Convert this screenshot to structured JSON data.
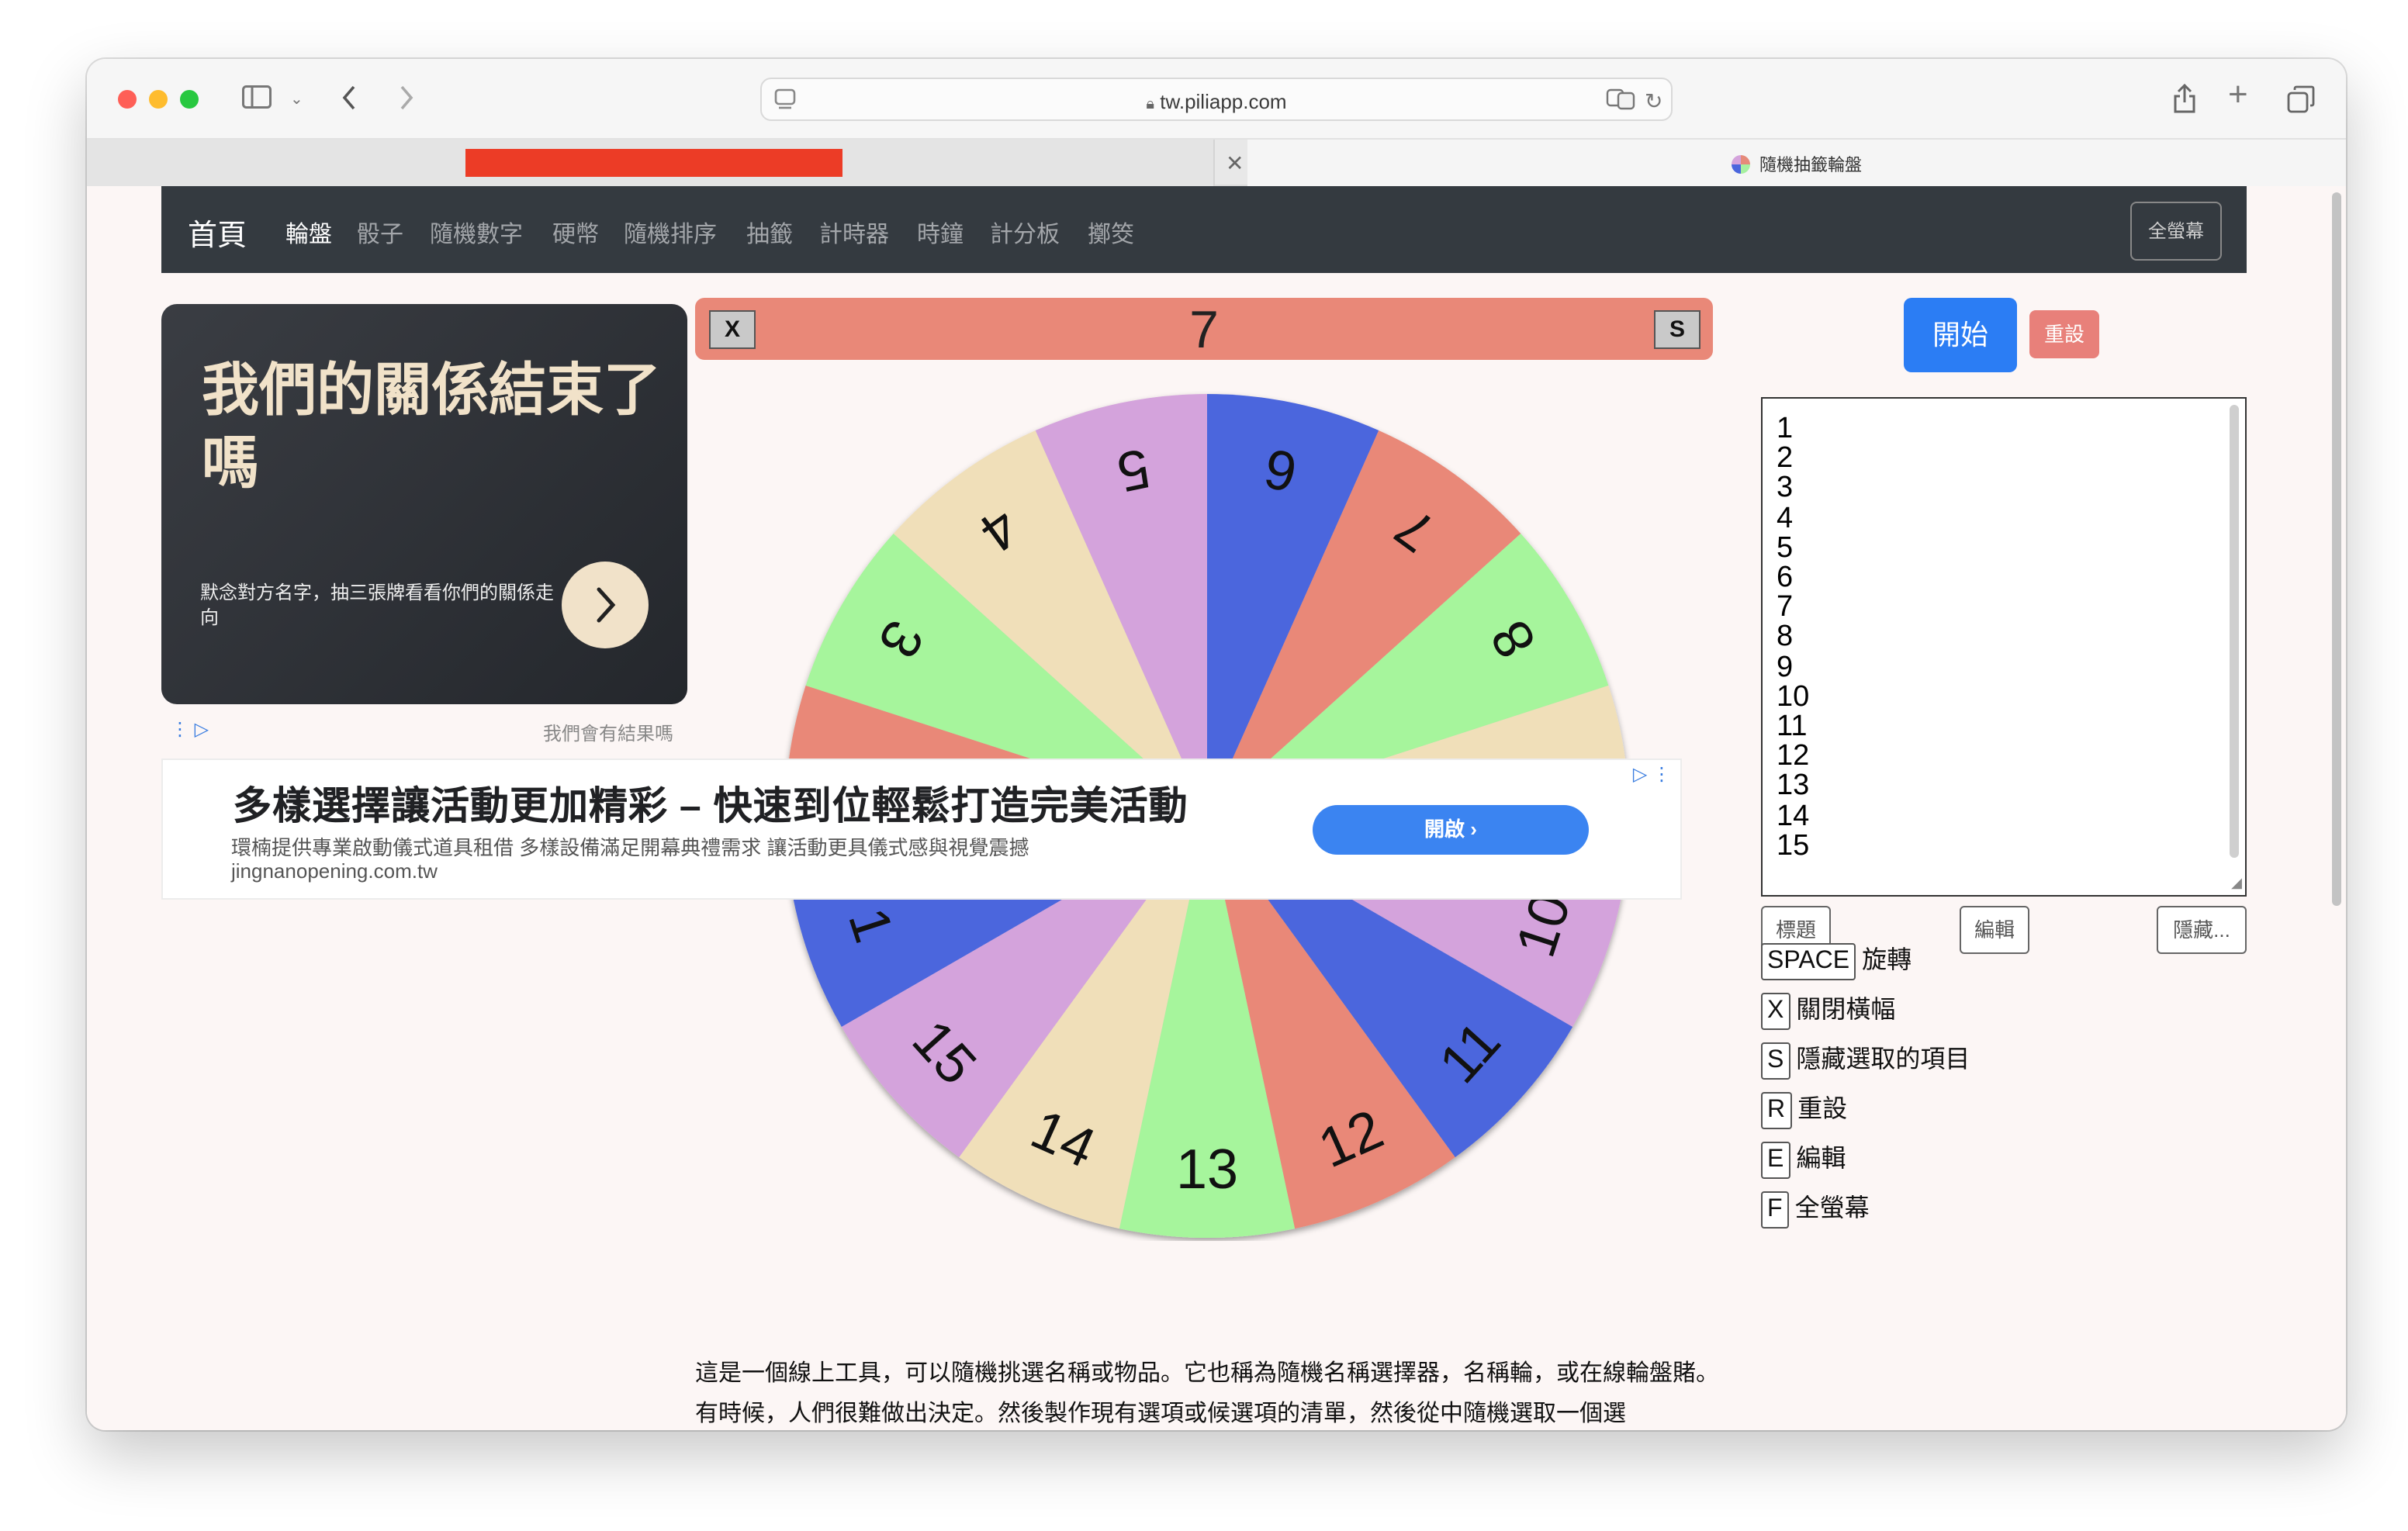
{
  "browser": {
    "url": "tw.piliapp.com",
    "tab_title": "隨機抽籤輪盤"
  },
  "nav": {
    "brand": "首頁",
    "items": [
      {
        "label": "輪盤",
        "active": true
      },
      {
        "label": "骰子",
        "active": false
      },
      {
        "label": "隨機數字",
        "active": false
      },
      {
        "label": "硬幣",
        "active": false
      },
      {
        "label": "隨機排序",
        "active": false
      },
      {
        "label": "抽籤",
        "active": false
      },
      {
        "label": "計時器",
        "active": false
      },
      {
        "label": "時鐘",
        "active": false
      },
      {
        "label": "計分板",
        "active": false
      },
      {
        "label": "擲筊",
        "active": false
      }
    ],
    "fullscreen": "全螢幕"
  },
  "ad_top": {
    "title": "我們的關係結束了嗎",
    "subtitle": "默念對方名字，抽三張牌看看你們的關係走向",
    "caption": "我們會有結果嗎"
  },
  "banner": {
    "close_key": "X",
    "hide_key": "S",
    "selected": "7"
  },
  "wheel": {
    "items": [
      "1",
      "2",
      "3",
      "4",
      "5",
      "6",
      "7",
      "8",
      "9",
      "10",
      "11",
      "12",
      "13",
      "14",
      "15"
    ],
    "colors": [
      "#4b66dd",
      "#e98878",
      "#a6f59c",
      "#f0dfb9",
      "#d4a3dc"
    ]
  },
  "ad_banner": {
    "headline": "多樣選擇讓活動更加精彩 – 快速到位輕鬆打造完美活動",
    "description": "環楠提供專業啟動儀式道具租借 多樣設備滿足開幕典禮需求 讓活動更具儀式感與視覺震撼",
    "url": "jingnanopening.com.tw",
    "cta": "開啟"
  },
  "controls": {
    "start": "開始",
    "reset": "重設",
    "title_btn": "標題",
    "edit_btn": "編輯",
    "hide_btn": "隱藏..."
  },
  "list": [
    "1",
    "2",
    "3",
    "4",
    "5",
    "6",
    "7",
    "8",
    "9",
    "10",
    "11",
    "12",
    "13",
    "14",
    "15"
  ],
  "shortcuts": [
    {
      "key": "SPACE",
      "label": "旋轉"
    },
    {
      "key": "X",
      "label": "關閉橫幅"
    },
    {
      "key": "S",
      "label": "隱藏選取的項目"
    },
    {
      "key": "R",
      "label": "重設"
    },
    {
      "key": "E",
      "label": "編輯"
    },
    {
      "key": "F",
      "label": "全螢幕"
    }
  ],
  "description": "這是一個線上工具，可以隨機挑選名稱或物品。它也稱為隨機名稱選擇器，名稱輪，或在線輪盤賭。有時候，人們很難做出決定。然後製作現有選項或候選項的清單，然後從中隨機選取一個選"
}
